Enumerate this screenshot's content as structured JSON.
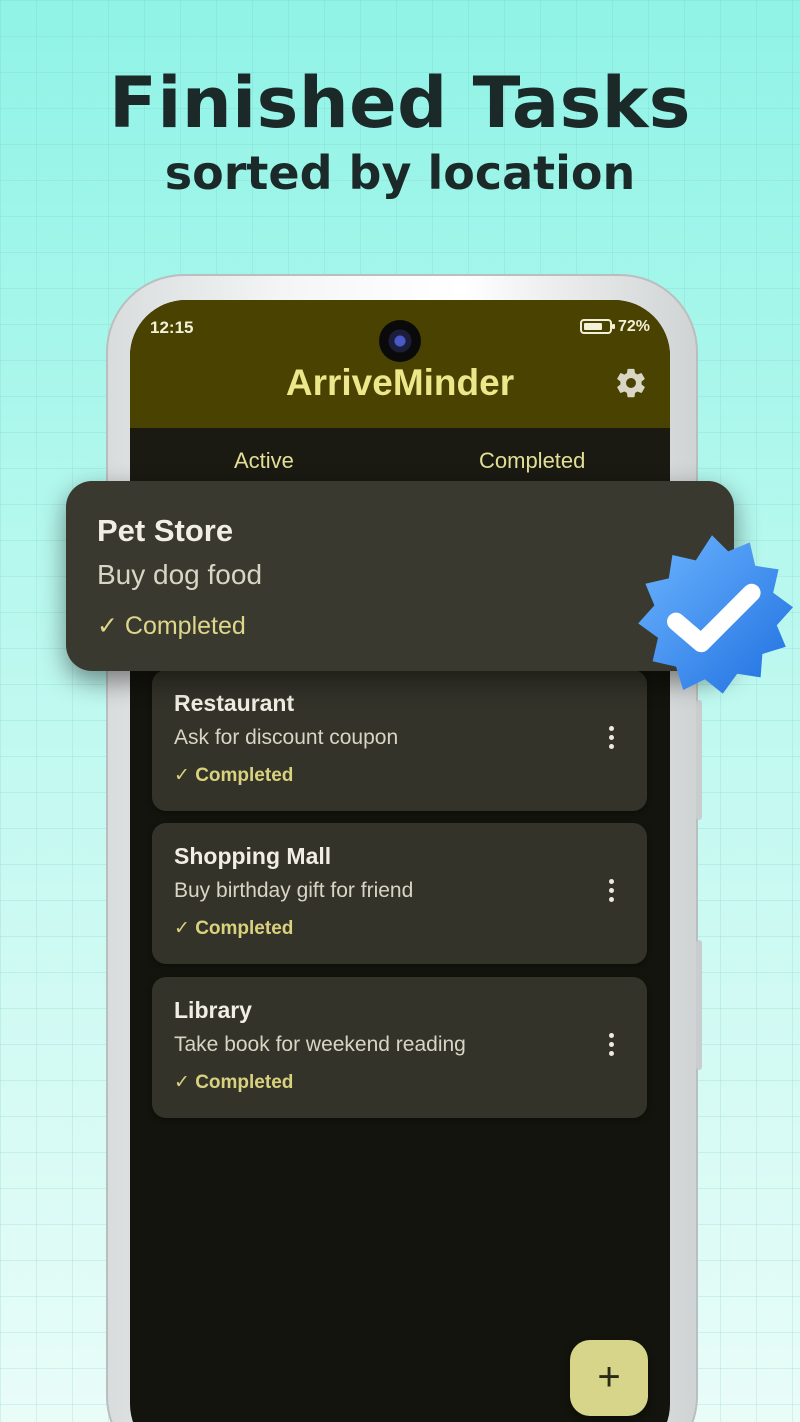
{
  "promo": {
    "headline": "Finished Tasks",
    "subline": "sorted by location"
  },
  "status_bar": {
    "time": "12:15",
    "battery": "72%"
  },
  "app_bar": {
    "title": "ArriveMinder",
    "settings_icon": "gear-icon"
  },
  "tabs": [
    {
      "label": "Active",
      "selected": false
    },
    {
      "label": "Completed",
      "selected": true
    }
  ],
  "featured_task": {
    "location": "Pet Store",
    "task": "Buy dog food",
    "status": "✓ Completed",
    "badge_icon": "verified-badge-icon"
  },
  "tasks": [
    {
      "location": "Restaurant",
      "task": "Ask for discount coupon",
      "status": "✓ Completed",
      "menu_icon": "more-vertical-icon"
    },
    {
      "location": "Shopping Mall",
      "task": "Buy birthday gift for friend",
      "status": "✓ Completed",
      "menu_icon": "more-vertical-icon"
    },
    {
      "location": "Library",
      "task": "Take book for weekend reading",
      "status": "✓ Completed",
      "menu_icon": "more-vertical-icon"
    }
  ],
  "fab": {
    "label": "+",
    "icon": "plus-icon"
  },
  "colors": {
    "app_bar": "#4a4200",
    "accent": "#d7d58a",
    "card": "#34332a",
    "screen_bg": "#14140e"
  }
}
